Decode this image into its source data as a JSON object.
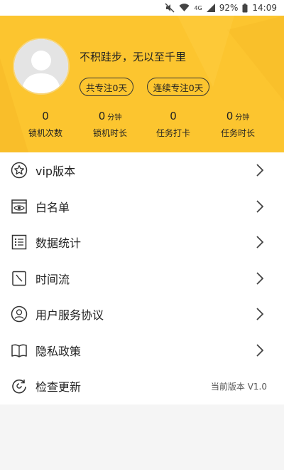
{
  "status_bar": {
    "network": "4G",
    "battery": "92%",
    "time": "14:09"
  },
  "profile": {
    "motto": "不积跬步，无以至千里",
    "focus_total_pill": "共专注0天",
    "focus_streak_pill": "连续专注0天"
  },
  "stats": [
    {
      "value": "0",
      "unit": "",
      "label": "锁机次数"
    },
    {
      "value": "0",
      "unit": "分钟",
      "label": "锁机时长"
    },
    {
      "value": "0",
      "unit": "",
      "label": "任务打卡"
    },
    {
      "value": "0",
      "unit": "分钟",
      "label": "任务时长"
    }
  ],
  "menu": [
    {
      "label": "vip版本",
      "icon": "star-icon"
    },
    {
      "label": "白名单",
      "icon": "eye-icon"
    },
    {
      "label": "数据统计",
      "icon": "list-icon"
    },
    {
      "label": "时间流",
      "icon": "clock-icon"
    },
    {
      "label": "用户服务协议",
      "icon": "user-icon"
    },
    {
      "label": "隐私政策",
      "icon": "book-icon"
    },
    {
      "label": "检查更新",
      "icon": "refresh-icon",
      "right_text": "当前版本 V1.0"
    }
  ],
  "colors": {
    "header_bg": "#fcc52f",
    "page_bg": "#f5f5f5"
  }
}
